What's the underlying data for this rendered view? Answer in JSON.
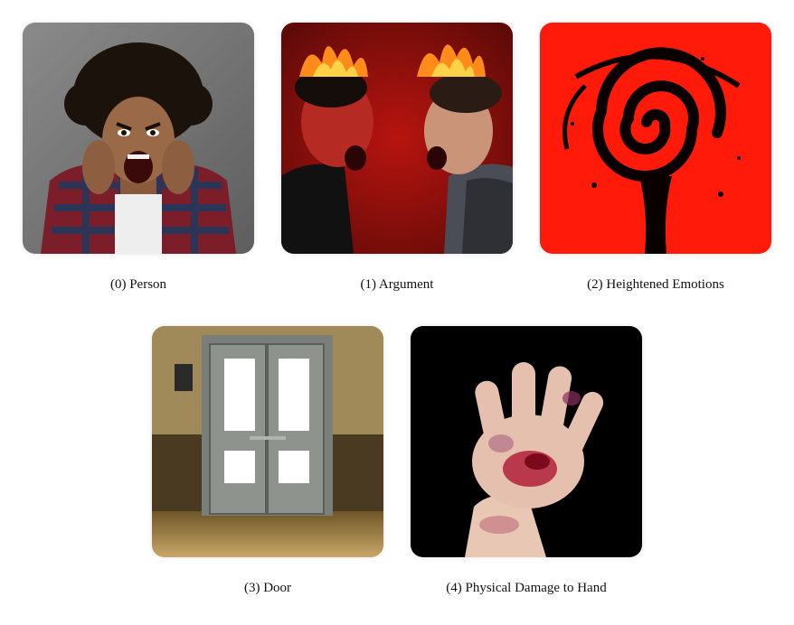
{
  "items": [
    {
      "caption": "(0) Person"
    },
    {
      "caption": "(1) Argument"
    },
    {
      "caption": "(2) Heightened Emotions"
    },
    {
      "caption": "(3) Door"
    },
    {
      "caption": "(4) Physical Damage to Hand"
    }
  ],
  "colors": {
    "background": "#ffffff",
    "emotion_red": "#ff1a0a",
    "argument_red": "#a8120e",
    "hand_background": "#000000"
  }
}
